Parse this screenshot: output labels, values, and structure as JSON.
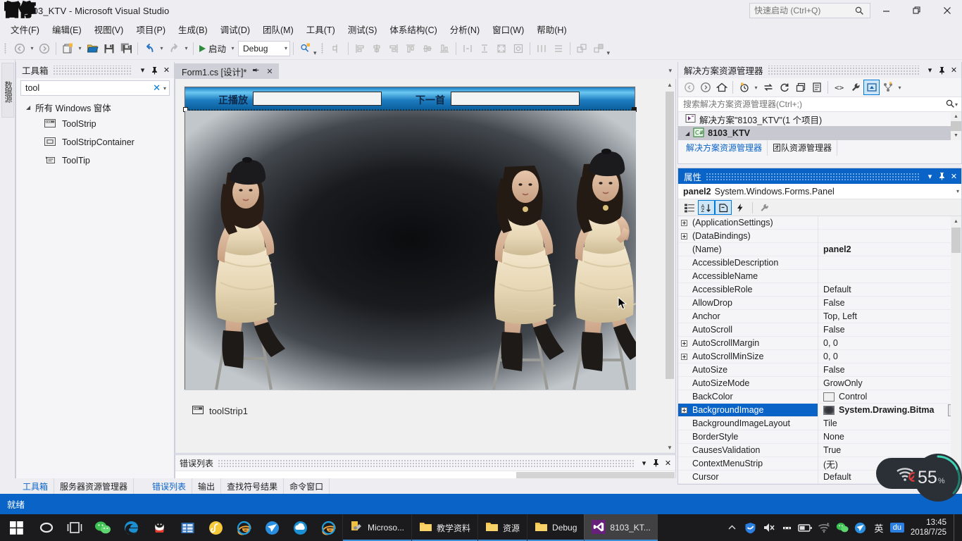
{
  "window": {
    "title": "8103_KTV - Microsoft Visual Studio",
    "quick_launch_placeholder": "快速启动 (Ctrl+Q)",
    "minimize": "—",
    "restore": "❐",
    "close": "✕",
    "ink_overlay_text": "暂停"
  },
  "menu": {
    "items": [
      "文件(F)",
      "编辑(E)",
      "视图(V)",
      "项目(P)",
      "生成(B)",
      "调试(D)",
      "团队(M)",
      "工具(T)",
      "测试(S)",
      "体系结构(C)",
      "分析(N)",
      "窗口(W)",
      "帮助(H)"
    ]
  },
  "toolbar": {
    "back_title": "后退",
    "forward_title": "前进",
    "new_project_title": "新建项目",
    "open_file_title": "打开文件",
    "save_title": "保存",
    "save_all_title": "全部保存",
    "undo_title": "撤消",
    "redo_title": "恢复",
    "start_label": "启动",
    "config_value": "Debug",
    "find_title": "在文件中查找",
    "overflow": "▾"
  },
  "vertical_tab": {
    "label": "数据源"
  },
  "toolbox": {
    "title": "工具箱",
    "dropdown": "▾",
    "pin": "⚲",
    "close": "✕",
    "search_value": "tool",
    "clear": "✕",
    "options_arrow": "▾",
    "group": {
      "caret": "◢",
      "label": "所有 Windows 窗体"
    },
    "items": [
      {
        "label": "ToolStrip",
        "icon": "toolstrip-icon"
      },
      {
        "label": "ToolStripContainer",
        "icon": "toolstripcontainer-icon"
      },
      {
        "label": "ToolTip",
        "icon": "tooltip-icon"
      }
    ]
  },
  "document": {
    "tab_label": "Form1.cs [设计]*",
    "tab_pin": "⚲",
    "tab_close": "✕",
    "strip_arrow": "▾"
  },
  "form_designer": {
    "now_playing_label": "正播放",
    "next_song_label": "下一首",
    "component_tray_item": "toolStrip1",
    "scroll_up": "▲",
    "scroll_down": "▼"
  },
  "error_list": {
    "title": "错误列表",
    "dropdown": "▾",
    "pin": "⚲",
    "close": "✕"
  },
  "bottom_tabs": {
    "left": [
      {
        "label": "工具箱",
        "active": true
      },
      {
        "label": "服务器资源管理器",
        "active": false
      }
    ],
    "right": [
      {
        "label": "错误列表",
        "active": true
      },
      {
        "label": "输出",
        "active": false
      },
      {
        "label": "查找符号结果",
        "active": false
      },
      {
        "label": "命令窗口",
        "active": false
      }
    ]
  },
  "solution_explorer": {
    "title": "解决方案资源管理器",
    "dropdown": "▾",
    "pin": "⚲",
    "close": "✕",
    "search_placeholder": "搜索解决方案资源管理器(Ctrl+;)",
    "search_icon": "magnifier-icon",
    "search_arrow": "▾",
    "toolbar_buttons": [
      "back-icon",
      "forward-icon",
      "home-icon",
      "pending-changes-icon",
      "sync-icon",
      "refresh-icon",
      "collapse-all-icon",
      "properties-page-icon",
      "show-all-files-icon",
      "wrench-icon",
      "view-designer-icon",
      "class-view-icon"
    ],
    "toolbar_overflow": "▾",
    "tree": [
      {
        "label": "解决方案\"8103_KTV\"(1 个项目)",
        "icon": "solution-icon",
        "selected": false,
        "indent": 10
      },
      {
        "label": "8103_KTV",
        "icon": "csharp-project-icon",
        "selected": true,
        "indent": 24
      }
    ],
    "tabs": [
      {
        "label": "解决方案资源管理器",
        "active": true
      },
      {
        "label": "团队资源管理器",
        "active": false
      }
    ]
  },
  "properties": {
    "title": "属性",
    "dropdown": "▾",
    "pin": "⚲",
    "close": "✕",
    "object_name": "panel2",
    "object_type": "System.Windows.Forms.Panel",
    "object_arrow": "▾",
    "toolbar": {
      "categorized": "categorized-icon",
      "alphabetical": "alphabetical-icon",
      "properties": "properties-icon",
      "events": "events-icon",
      "property_pages": "property-pages-icon"
    },
    "rows": [
      {
        "name": "(ApplicationSettings)",
        "value": "",
        "expandable": true,
        "selected": false,
        "bold": false
      },
      {
        "name": "(DataBindings)",
        "value": "",
        "expandable": true,
        "selected": false,
        "bold": false
      },
      {
        "name": "(Name)",
        "value": "panel2",
        "expandable": false,
        "selected": false,
        "bold": true
      },
      {
        "name": "AccessibleDescription",
        "value": "",
        "expandable": false,
        "selected": false,
        "bold": false
      },
      {
        "name": "AccessibleName",
        "value": "",
        "expandable": false,
        "selected": false,
        "bold": false
      },
      {
        "name": "AccessibleRole",
        "value": "Default",
        "expandable": false,
        "selected": false,
        "bold": false
      },
      {
        "name": "AllowDrop",
        "value": "False",
        "expandable": false,
        "selected": false,
        "bold": false
      },
      {
        "name": "Anchor",
        "value": "Top, Left",
        "expandable": false,
        "selected": false,
        "bold": false
      },
      {
        "name": "AutoScroll",
        "value": "False",
        "expandable": false,
        "selected": false,
        "bold": false
      },
      {
        "name": "AutoScrollMargin",
        "value": "0, 0",
        "expandable": true,
        "selected": false,
        "bold": false
      },
      {
        "name": "AutoScrollMinSize",
        "value": "0, 0",
        "expandable": true,
        "selected": false,
        "bold": false
      },
      {
        "name": "AutoSize",
        "value": "False",
        "expandable": false,
        "selected": false,
        "bold": false
      },
      {
        "name": "AutoSizeMode",
        "value": "GrowOnly",
        "expandable": false,
        "selected": false,
        "bold": false
      },
      {
        "name": "BackColor",
        "value": "Control",
        "expandable": false,
        "selected": false,
        "bold": false,
        "swatch": "color"
      },
      {
        "name": "BackgroundImage",
        "value": "System.Drawing.Bitma",
        "expandable": true,
        "selected": true,
        "bold": true,
        "swatch": "image",
        "ellipsis": "..."
      },
      {
        "name": "BackgroundImageLayout",
        "value": "Tile",
        "expandable": false,
        "selected": false,
        "bold": false
      },
      {
        "name": "BorderStyle",
        "value": "None",
        "expandable": false,
        "selected": false,
        "bold": false
      },
      {
        "name": "CausesValidation",
        "value": "True",
        "expandable": false,
        "selected": false,
        "bold": false
      },
      {
        "name": "ContextMenuStrip",
        "value": "(无)",
        "expandable": false,
        "selected": false,
        "bold": false
      },
      {
        "name": "Cursor",
        "value": "Default",
        "expandable": false,
        "selected": false,
        "bold": false
      }
    ],
    "scroll_up": "▲",
    "scroll_down": "▼"
  },
  "status_bar": {
    "text": "就绪"
  },
  "recorder_widget": {
    "value": "55",
    "unit": "%",
    "icon": "wifi-disabled-icon"
  },
  "taskbar": {
    "start_icon": "windows-start-icon",
    "pinned": [
      {
        "icon": "cortana-icon",
        "name": "cortana"
      },
      {
        "icon": "task-view-icon",
        "name": "task-view"
      },
      {
        "icon": "wechat-icon",
        "name": "wechat"
      },
      {
        "icon": "edge-icon",
        "name": "edge"
      },
      {
        "icon": "qq-icon",
        "name": "qq"
      },
      {
        "icon": "folder-blue-icon",
        "name": "file-explorer"
      },
      {
        "icon": "netease-music-icon",
        "name": "netease-music"
      },
      {
        "icon": "ie-icon",
        "name": "internet-explorer"
      },
      {
        "icon": "foxmail-icon",
        "name": "foxmail"
      },
      {
        "icon": "qq-browser-icon",
        "name": "qq-browser"
      },
      {
        "icon": "ie-icon-2",
        "name": "internet-explorer-2"
      }
    ],
    "tasks": [
      {
        "label": "Microso...",
        "icon": "visual-studio-setup-icon",
        "active": false
      },
      {
        "label": "教学资料",
        "icon": "folder-icon",
        "active": false
      },
      {
        "label": "资源",
        "icon": "folder-icon",
        "active": false
      },
      {
        "label": "Debug",
        "icon": "folder-icon",
        "active": false
      },
      {
        "label": "8103_KT...",
        "icon": "visual-studio-icon",
        "active": true
      }
    ],
    "tray": {
      "chevron": "⌃",
      "icons": [
        "shield-icon",
        "volume-muted-icon",
        "ninja-icon",
        "battery-icon",
        "wifi-icon",
        "wechat-tray-icon",
        "foxmail-tray-icon"
      ],
      "ime": "英",
      "ime_extra": "du",
      "time": "13:45",
      "date": "2018/7/25"
    }
  }
}
